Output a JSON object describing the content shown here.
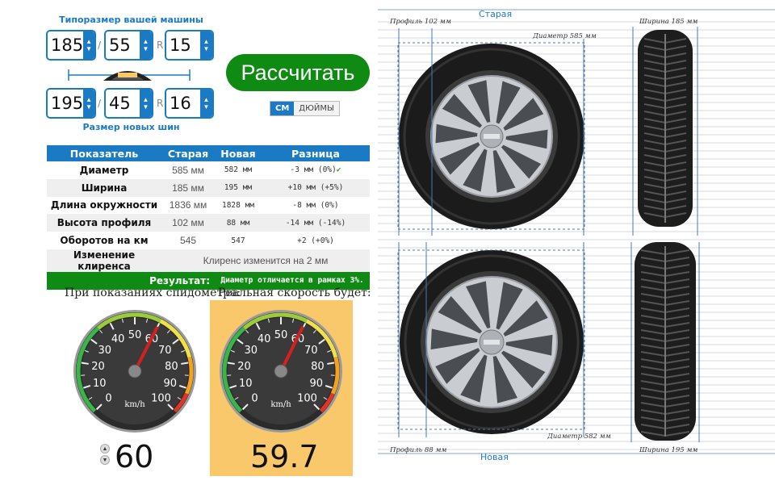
{
  "calculator": {
    "current_size_label": "Типоразмер вашей машины",
    "new_size_label": "Размер новых шин",
    "separator": "/",
    "r_label": "R",
    "current": {
      "width": "185",
      "profile": "55",
      "rim": "15"
    },
    "new": {
      "width": "195",
      "profile": "45",
      "rim": "16"
    },
    "calc_button": "Рассчитать",
    "units": {
      "cm": "СМ",
      "inches": "ДЮЙМЫ"
    }
  },
  "table": {
    "headers": [
      "Показатель",
      "Старая",
      "Новая",
      "Разница"
    ],
    "rows": [
      {
        "name": "Диаметр",
        "old": "585 мм",
        "new": "582 мм",
        "diff": "-3 мм (0%)"
      },
      {
        "name": "Ширина",
        "old": "185 мм",
        "new": "195 мм",
        "diff": "+10 мм (+5%)"
      },
      {
        "name": "Длина окружности",
        "old": "1836 мм",
        "new": "1828 мм",
        "diff": "-8 мм (0%)"
      },
      {
        "name": "Высота профиля",
        "old": "102 мм",
        "new": "88 мм",
        "diff": "-14 мм (-14%)"
      },
      {
        "name": "Оборотов на км",
        "old": "545",
        "new": "547",
        "diff": "+2 (+0%)"
      }
    ],
    "clearance": {
      "name": "Изменение клиренса",
      "value": "Клиренс изменится на 2 мм"
    },
    "result": {
      "label": "Результат:",
      "value": "Диаметр отличается в рамках 3%."
    }
  },
  "speed": {
    "shown_caption": "При показаниях спидометра:",
    "real_caption": "Реальная скорость будет:",
    "shown_value": "60",
    "real_value": "59.7",
    "unit": "km/h",
    "ticks": [
      "0",
      "10",
      "20",
      "30",
      "40",
      "50",
      "60",
      "70",
      "80",
      "90",
      "100"
    ],
    "needle_shown": 60,
    "needle_real": 59.7
  },
  "diagram": {
    "old_label": "Старая",
    "new_label": "Новая",
    "old_profile": "Профиль 102 мм",
    "old_diameter": "Диаметр 585 мм",
    "old_width": "Ширина 185 мм",
    "new_profile": "Профиль 88 мм",
    "new_diameter": "Диаметр 582 мм",
    "new_width": "Ширина 195 мм"
  },
  "colors": {
    "accent": "#1a7bc4",
    "green": "#0f8a12",
    "highlight": "#f8c86a"
  }
}
